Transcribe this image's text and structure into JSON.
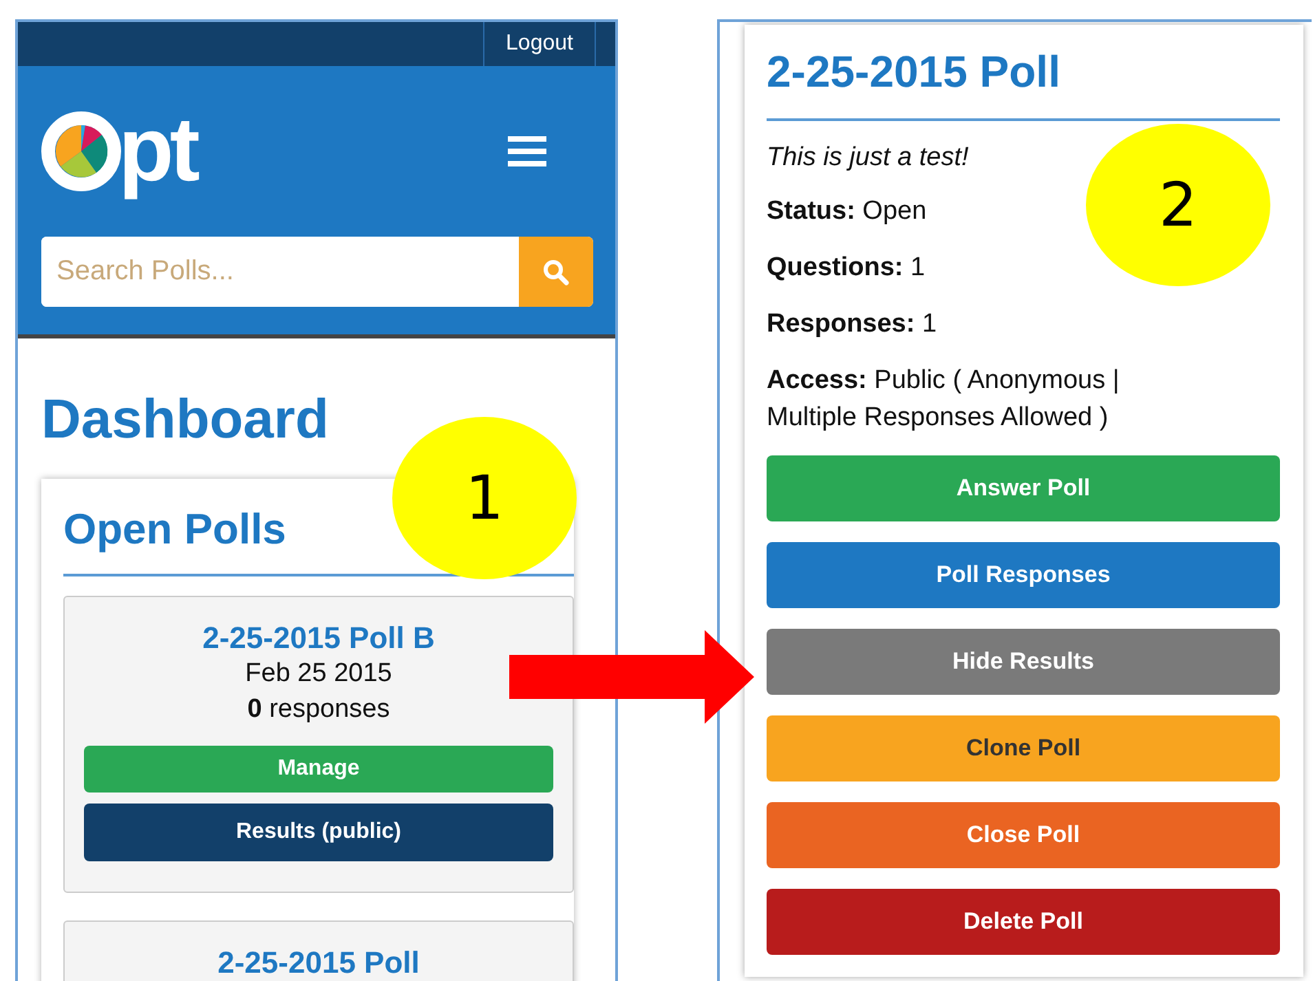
{
  "header": {
    "logout": "Logout",
    "logo_text": "pt",
    "search": {
      "placeholder": "Search Polls..."
    }
  },
  "page_title": "Dashboard",
  "open_polls": {
    "title": "Open Polls",
    "polls": [
      {
        "title": "2-25-2015 Poll B",
        "date": "Feb 25 2015",
        "responses": "**0** responses",
        "buttons": [
          {
            "label": "Manage",
            "kind": "manage"
          },
          {
            "label": "Results (public)",
            "kind": "results"
          }
        ]
      },
      {
        "title": "2-25-2015 Poll"
      }
    ]
  },
  "poll_detail": {
    "title": "2-25-2015 Poll",
    "description": "This is just a test!",
    "fields": [
      "**Status:** Open",
      "**Questions:** 1",
      "**Responses:** 1",
      "**Access:** Public ( Anonymous | Multiple Responses Allowed )"
    ],
    "actions": [
      {
        "label": "Answer Poll",
        "kind": "answer"
      },
      {
        "label": "Poll Responses",
        "kind": "responses"
      },
      {
        "label": "Hide Results",
        "kind": "hide"
      },
      {
        "label": "Clone Poll",
        "kind": "clone"
      },
      {
        "label": "Close Poll",
        "kind": "close"
      },
      {
        "label": "Delete Poll",
        "kind": "delete"
      }
    ]
  },
  "annotations": [
    {
      "kind": "number",
      "text": "1"
    },
    {
      "kind": "number",
      "text": "2"
    },
    {
      "kind": "arrow"
    }
  ]
}
